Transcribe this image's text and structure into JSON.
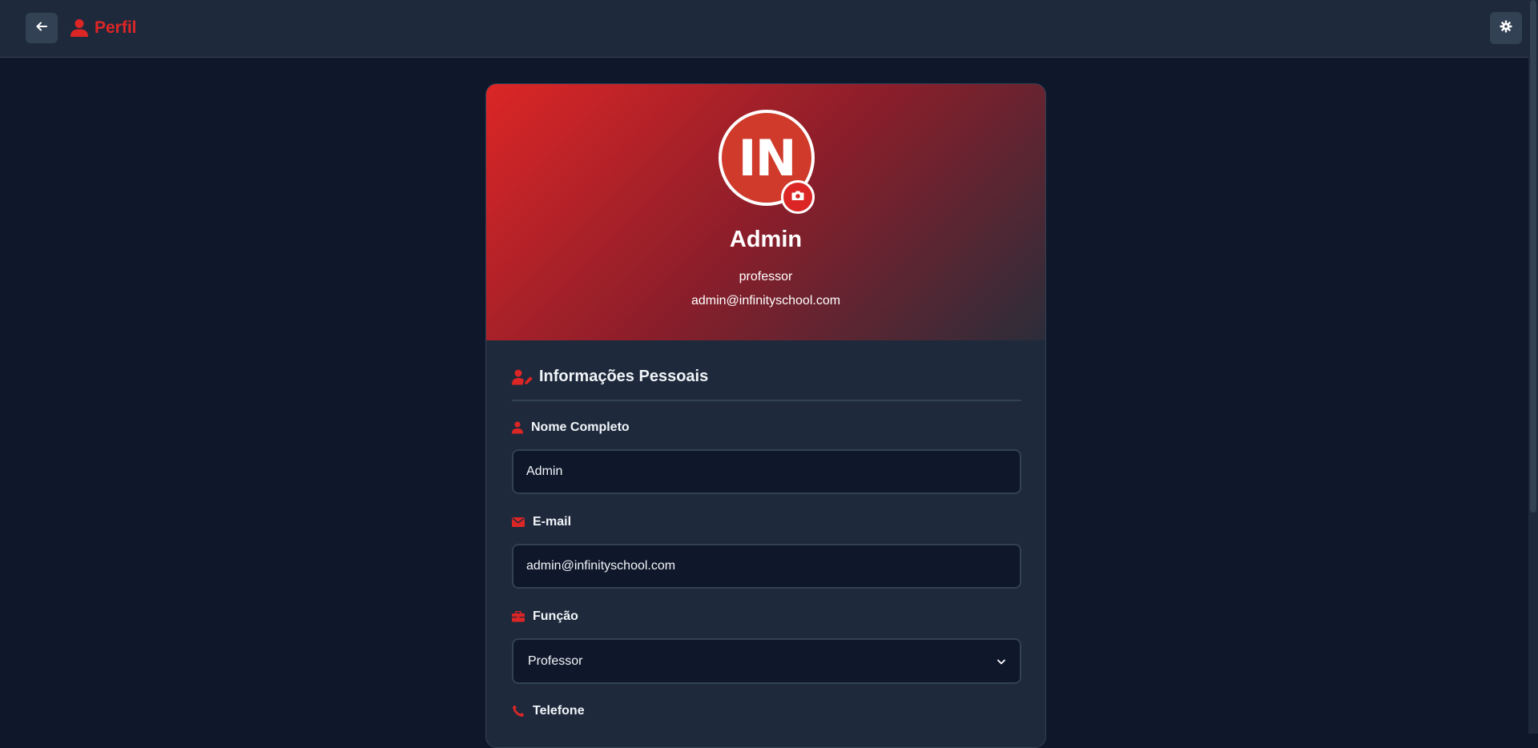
{
  "header": {
    "title": "Perfil",
    "back_icon": "arrow-left-icon",
    "title_icon": "user-icon",
    "settings_icon": "gear-icon"
  },
  "profile": {
    "avatar_text": "IN",
    "name": "Admin",
    "role": "professor",
    "email": "admin@infinityschool.com"
  },
  "section": {
    "title": "Informações Pessoais",
    "icon": "user-edit-icon"
  },
  "fields": {
    "name": {
      "label": "Nome Completo",
      "value": "Admin",
      "icon": "user-icon"
    },
    "email": {
      "label": "E-mail",
      "value": "admin@infinityschool.com",
      "icon": "envelope-icon"
    },
    "role": {
      "label": "Função",
      "value": "Professor",
      "icon": "briefcase-icon"
    },
    "phone": {
      "label": "Telefone",
      "icon": "phone-icon"
    }
  },
  "colors": {
    "accent": "#dc2626",
    "background": "#0f172a",
    "surface": "#1e293b",
    "border": "#334155"
  }
}
